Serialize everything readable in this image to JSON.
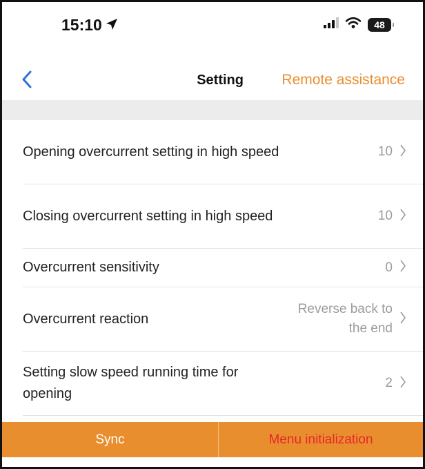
{
  "status_bar": {
    "time": "15:10",
    "battery": "48"
  },
  "nav": {
    "title": "Setting",
    "remote_label": "Remote assistance"
  },
  "settings": [
    {
      "label": "Opening overcurrent setting in high speed",
      "value": "10"
    },
    {
      "label": "Closing overcurrent setting in high speed",
      "value": "10"
    },
    {
      "label": "Overcurrent sensitivity",
      "value": "0"
    },
    {
      "label": "Overcurrent reaction",
      "value": "Reverse back to the end"
    },
    {
      "label": "Setting slow speed running time for opening",
      "value": "2"
    }
  ],
  "buttons": {
    "sync": "Sync",
    "menu_init": "Menu initialization"
  },
  "colors": {
    "accent": "#e98e2e",
    "danger": "#e8262a",
    "value_gray": "#9b9b9b"
  },
  "icons": {
    "back": "chevron-left-icon",
    "row_arrow": "chevron-right-icon",
    "location": "location-arrow-icon",
    "signal": "signal-bars-icon",
    "wifi": "wifi-icon",
    "battery": "battery-icon"
  }
}
